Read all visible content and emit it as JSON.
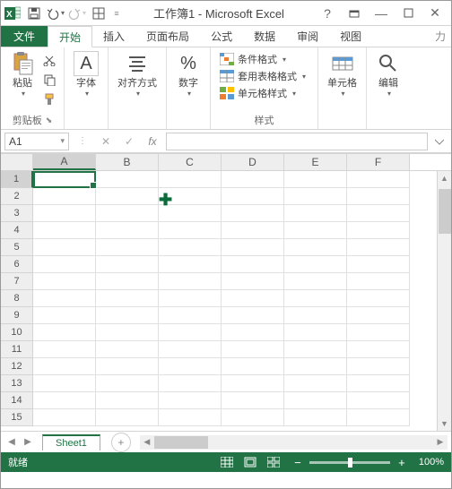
{
  "title": "工作簿1 - Microsoft Excel",
  "tabs": {
    "file": "文件",
    "items": [
      "开始",
      "插入",
      "页面布局",
      "公式",
      "数据",
      "审阅",
      "视图"
    ],
    "active": 0
  },
  "ribbon": {
    "clipboard": {
      "paste": "粘贴",
      "label": "剪贴板"
    },
    "font": {
      "btn": "字体",
      "label": "字体",
      "letter": "A"
    },
    "align": {
      "btn": "对齐方式",
      "label": "对齐方式"
    },
    "number": {
      "btn": "数字",
      "label": "数字",
      "sym": "%"
    },
    "styles": {
      "cond": "条件格式",
      "table": "套用表格格式",
      "cell": "单元格样式",
      "label": "样式"
    },
    "cells": {
      "btn": "单元格",
      "label": ""
    },
    "edit": {
      "btn": "编辑",
      "label": ""
    }
  },
  "formula": {
    "name": "A1",
    "value": ""
  },
  "cols": [
    "A",
    "B",
    "C",
    "D",
    "E",
    "F"
  ],
  "rows": [
    "1",
    "2",
    "3",
    "4",
    "5",
    "6",
    "7",
    "8",
    "9",
    "10",
    "11",
    "12",
    "13",
    "14",
    "15"
  ],
  "activeCol": 0,
  "activeRow": 0,
  "sheet": {
    "name": "Sheet1"
  },
  "status": {
    "ready": "就绪",
    "zoom": "100%"
  }
}
